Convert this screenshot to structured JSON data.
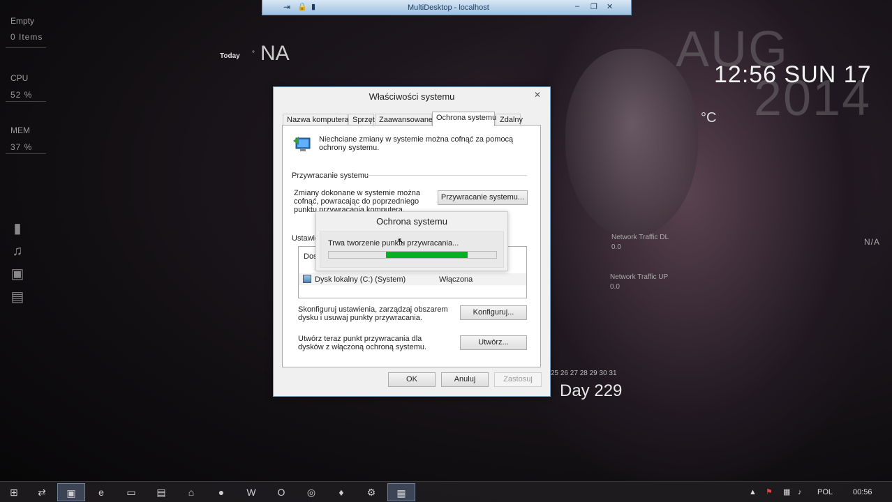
{
  "topbar": {
    "title": "MultiDesktop - localhost"
  },
  "left_widgets": {
    "recycle_label": "Empty",
    "recycle_items": "0 Items",
    "cpu_label": "CPU",
    "cpu_value": "52 %",
    "mem_label": "MEM",
    "mem_value": "37 %"
  },
  "weather": {
    "today_label": "Today",
    "today_value": "NA",
    "temp_unit": "°C",
    "right_value": "N/A"
  },
  "clock": {
    "time": "12:56 SUN 17",
    "bg_month": "AUG",
    "bg_year": "2014"
  },
  "network": {
    "dl_label": "Network Traffic DL",
    "dl_value": "0.0",
    "ul_label": "Network Traffic UP",
    "ul_value": "0.0"
  },
  "calendar": {
    "days": "25 26 27 28 29 30 31",
    "bigline_visible": "Day 229"
  },
  "dialog": {
    "title": "Właściwości systemu",
    "close": "✕",
    "tabs": [
      "Nazwa komputera",
      "Sprzęt",
      "Zaawansowane",
      "Ochrona systemu",
      "Zdalny"
    ],
    "intro": "Niechciane zmiany w systemie można cofnąć za pomocą ochrony systemu.",
    "restore_section": "Przywracanie systemu",
    "restore_desc": "Zmiany dokonane w systemie można cofnąć, powracając do poprzedniego punktu przywracania komputera.",
    "restore_button": "Przywracanie systemu...",
    "settings_section": "Ustawie",
    "list_header": "Dos",
    "drive_name": "Dysk lokalny (C:) (System)",
    "drive_status": "Włączona",
    "configure_desc": "Skonfiguruj ustawienia, zarządzaj obszarem dysku i usuwaj punkty przywracania.",
    "configure_button": "Konfiguruj...",
    "create_desc": "Utwórz teraz punkt przywracania dla dysków z włączoną ochroną systemu.",
    "create_button": "Utwórz...",
    "ok": "OK",
    "cancel": "Anuluj",
    "apply": "Zastosuj"
  },
  "progress": {
    "title": "Ochrona systemu",
    "message": "Trwa tworzenie punktu przywracania...",
    "fill_start": 0.34,
    "fill_end": 0.83
  },
  "tray": {
    "language": "POL",
    "time": "00:56"
  },
  "colors": {
    "progress": "#06b025",
    "taskbar": "#1e1c20"
  }
}
